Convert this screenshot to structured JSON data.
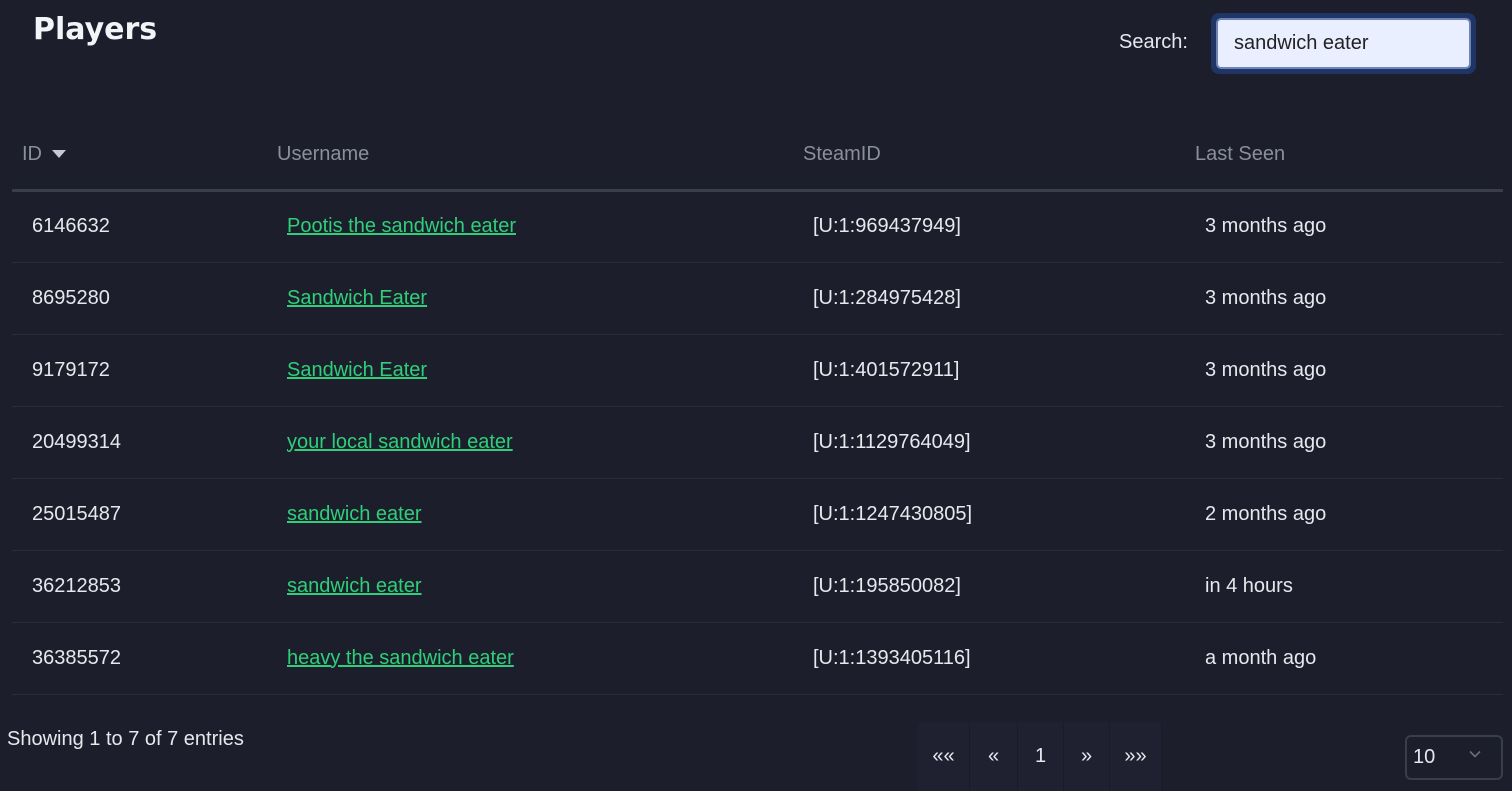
{
  "header": {
    "title": "Players"
  },
  "search": {
    "label": "Search:",
    "value": "sandwich eater"
  },
  "table": {
    "columns": {
      "id": "ID",
      "username": "Username",
      "steamid": "SteamID",
      "last_seen": "Last Seen"
    },
    "rows": [
      {
        "id": "6146632",
        "username": "Pootis the sandwich eater",
        "steamid": "[U:1:969437949]",
        "last_seen": "3 months ago"
      },
      {
        "id": "8695280",
        "username": "Sandwich Eater",
        "steamid": "[U:1:284975428]",
        "last_seen": "3 months ago"
      },
      {
        "id": "9179172",
        "username": "Sandwich Eater",
        "steamid": "[U:1:401572911]",
        "last_seen": "3 months ago"
      },
      {
        "id": "20499314",
        "username": "your local sandwich eater",
        "steamid": "[U:1:1129764049]",
        "last_seen": "3 months ago"
      },
      {
        "id": "25015487",
        "username": "sandwich eater",
        "steamid": "[U:1:1247430805]",
        "last_seen": "2 months ago"
      },
      {
        "id": "36212853",
        "username": "sandwich eater",
        "steamid": "[U:1:195850082]",
        "last_seen": "in 4 hours"
      },
      {
        "id": "36385572",
        "username": "heavy the sandwich eater",
        "steamid": "[U:1:1393405116]",
        "last_seen": "a month ago"
      }
    ]
  },
  "footer": {
    "info": "Showing 1 to 7 of 7 entries",
    "pager": {
      "first": "««",
      "prev": "«",
      "page": "1",
      "next": "»",
      "last": "»»"
    },
    "page_length": "10"
  },
  "colors": {
    "background": "#1c1e2b",
    "link": "#2fcf7a",
    "search_focus": "#1f3566"
  },
  "icons": {
    "sort": "sort-desc-icon",
    "select": "chevron-down-icon"
  }
}
